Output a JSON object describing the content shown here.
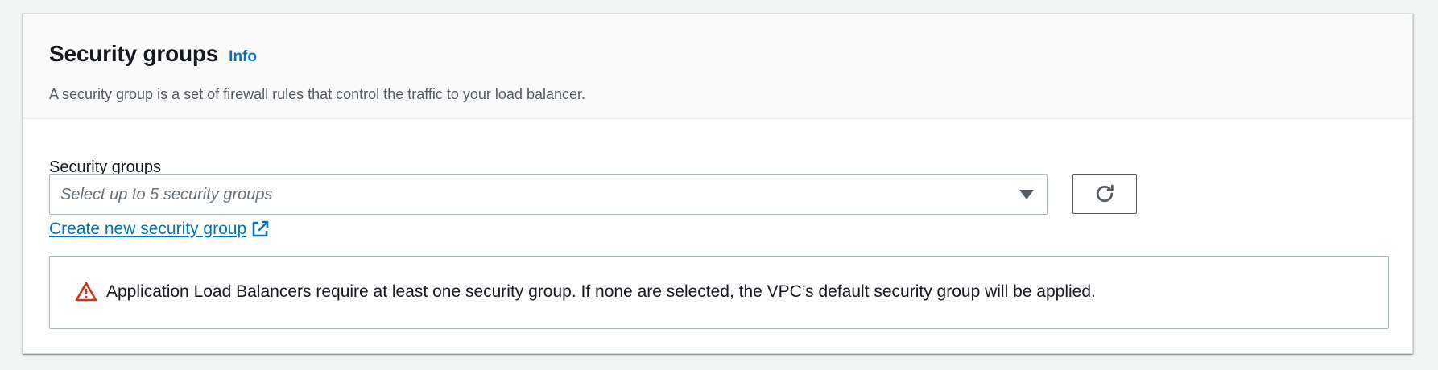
{
  "panel": {
    "title": "Security groups",
    "info_label": "Info",
    "description": "A security group is a set of firewall rules that control the traffic to your load balancer."
  },
  "field": {
    "label": "Security groups",
    "placeholder": "Select up to 5 security groups"
  },
  "links": {
    "create_new": "Create new security group"
  },
  "alert": {
    "type": "warning",
    "message": "Application Load Balancers require at least one security group. If none are selected, the VPC’s default security group will be applied."
  },
  "icons": {
    "caret": "caret-down-icon",
    "refresh": "refresh-icon",
    "external": "external-link-icon",
    "warning": "warning-icon"
  },
  "colors": {
    "link": "#0073bb",
    "warning": "#d13212",
    "text": "#16191f",
    "secondary_text": "#545b64"
  }
}
